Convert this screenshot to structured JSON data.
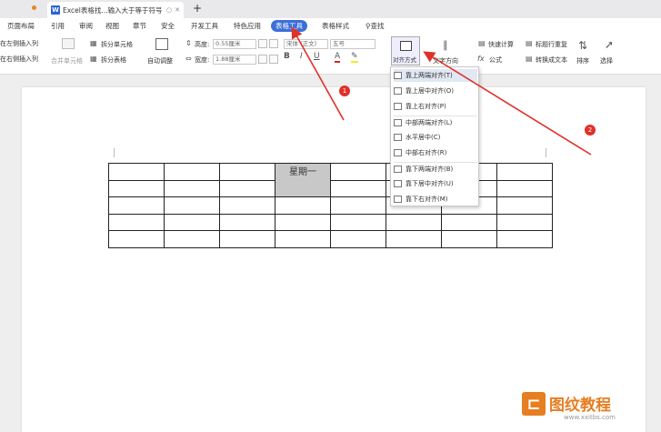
{
  "titlebar": {
    "doc_tab_title": "Excel表格找...输入大于等于符号",
    "doc_icon": "W",
    "new_tab": "+"
  },
  "menu": {
    "items": [
      "页面布局",
      "引用",
      "审阅",
      "视图",
      "章节",
      "安全",
      "开发工具",
      "特色应用",
      "表格工具",
      "表格样式",
      "查找"
    ],
    "active": "表格工具"
  },
  "ribbon": {
    "insert_left": "在左侧插入列",
    "insert_right": "在右侧插入列",
    "merge_cells": "合并单元格",
    "split_cells": "拆分单元格",
    "split_table": "拆分表格",
    "auto_adjust": "自动调整",
    "height_label": "高度:",
    "height_value": "0.55厘米",
    "width_label": "宽度:",
    "width_value": "1.88厘米",
    "font_name": "宋体 (正文)",
    "font_size": "五号",
    "bold": "B",
    "italic": "I",
    "underline": "U",
    "font_color": "A",
    "align_label": "对齐方式",
    "text_direction": "文字方向",
    "quick_calc": "快速计算",
    "formula": "公式",
    "repeat_header": "标题行重复",
    "to_text": "转换成文本",
    "sort": "排序",
    "select": "选择"
  },
  "dropdown": {
    "items": [
      "靠上两端对齐(T)",
      "靠上居中对齐(O)",
      "靠上右对齐(P)",
      "中部两端对齐(L)",
      "水平居中(C)",
      "中部右对齐(R)",
      "靠下两端对齐(B)",
      "靠下居中对齐(U)",
      "靠下右对齐(M)"
    ]
  },
  "table": {
    "header_cell": "星期一"
  },
  "annotations": {
    "badge1": "1",
    "badge2": "2"
  },
  "watermark": {
    "text": "图纹教程",
    "url": "www.xxitbs.com"
  },
  "colors": {
    "accent": "#3b6fd8",
    "arrow": "#e0302a",
    "cell_highlight": "#c8c8c8"
  }
}
